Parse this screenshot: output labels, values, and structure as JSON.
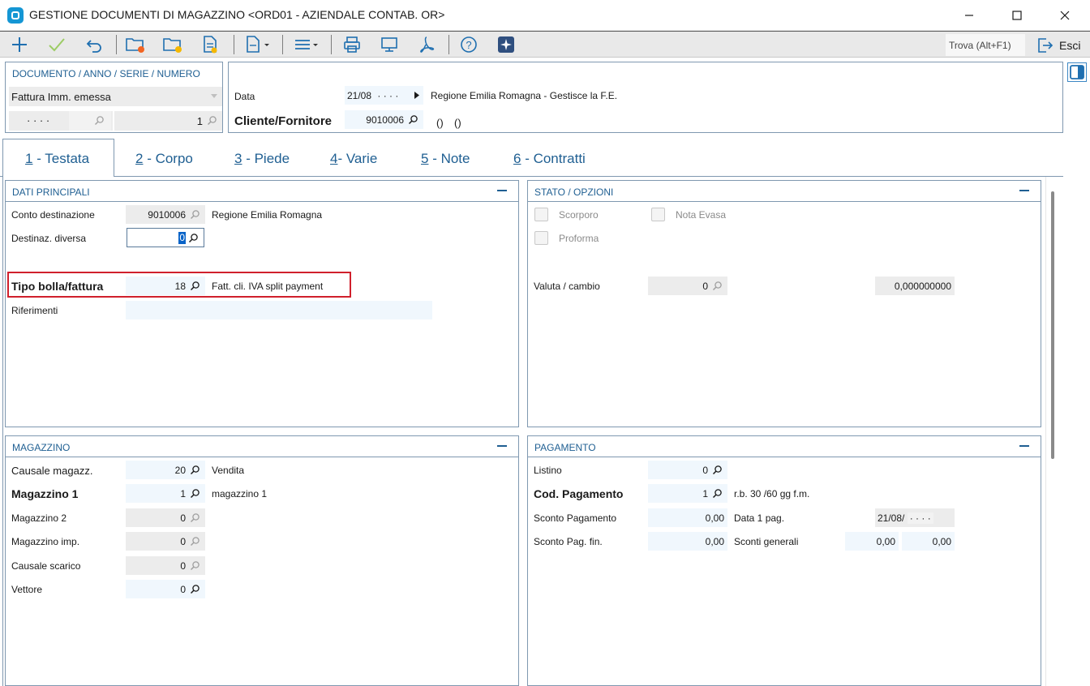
{
  "window": {
    "title": "GESTIONE DOCUMENTI DI MAGAZZINO <ORD01 - AZIENDALE CONTAB. OR>",
    "minimize": "—",
    "maximize": "☐",
    "close": "✕"
  },
  "toolbar": {
    "find_label": "Trova (Alt+F1)",
    "exit_label": "Esci"
  },
  "document": {
    "panel_title": "DOCUMENTO / ANNO / SERIE / NUMERO",
    "type": "Fattura Imm. emessa",
    "year": "· · · ·",
    "number": "1"
  },
  "header": {
    "date_label": "Data",
    "date_value": "21/08",
    "date_mask": "· · · ·",
    "client_label": "Cliente/Fornitore",
    "client_code": "9010006",
    "client_name": "Regione Emilia Romagna  - Gestisce la F.E.",
    "client_extra_1": "()",
    "client_extra_2": "()"
  },
  "tabs": [
    {
      "key": "1",
      "label": " - Testata",
      "active": true
    },
    {
      "key": "2",
      "label": " - Corpo",
      "active": false
    },
    {
      "key": "3",
      "label": " - Piede",
      "active": false
    },
    {
      "key": "4",
      "label": "- Varie",
      "active": false
    },
    {
      "key": "5",
      "label": " - Note",
      "active": false
    },
    {
      "key": "6",
      "label": " - Contratti",
      "active": false
    }
  ],
  "dati_principali": {
    "title": "DATI PRINCIPALI",
    "conto_label": "Conto destinazione",
    "conto_value": "9010006",
    "conto_desc": "Regione Emilia Romagna",
    "destinaz_label": "Destinaz. diversa",
    "destinaz_value": "0",
    "tipo_label": "Tipo bolla/fattura",
    "tipo_value": "18",
    "tipo_desc": "Fatt. cli. IVA split payment",
    "riferimenti_label": "Riferimenti",
    "riferimenti_value": ""
  },
  "stato_opzioni": {
    "title": "STATO / OPZIONI",
    "scorporo_label": "Scorporo",
    "nota_evasa_label": "Nota Evasa",
    "proforma_label": "Proforma",
    "valuta_label": "Valuta / cambio",
    "valuta_value": "0",
    "cambio_value": "0,000000000"
  },
  "magazzino": {
    "title": "MAGAZZINO",
    "causale_label": "Causale magazz.",
    "causale_value": "20",
    "causale_desc": "Vendita",
    "mag1_label": "Magazzino 1",
    "mag1_value": "1",
    "mag1_desc": "magazzino 1",
    "mag2_label": "Magazzino 2",
    "mag2_value": "0",
    "magimp_label": "Magazzino imp.",
    "magimp_value": "0",
    "scarico_label": "Causale scarico",
    "scarico_value": "0",
    "vettore_label": "Vettore",
    "vettore_value": "0"
  },
  "pagamento": {
    "title": "PAGAMENTO",
    "listino_label": "Listino",
    "listino_value": "0",
    "codpag_label": "Cod. Pagamento",
    "codpag_value": "1",
    "codpag_desc": "r.b. 30 /60 gg f.m.",
    "sconto_pag_label": "Sconto Pagamento",
    "sconto_pag_value": "0,00",
    "data1_label": "Data 1 pag.",
    "data1_value": "21/08/",
    "data1_mask": "· · · ·",
    "sconto_fin_label": "Sconto Pag. fin.",
    "sconto_fin_value": "0,00",
    "sconti_gen_label": "Sconti generali",
    "sconti_gen_1": "0,00",
    "sconti_gen_2": "0,00"
  },
  "colors": {
    "accent_blue": "#1f5f92",
    "border": "#7f98b0",
    "highlight_red": "#d0202c",
    "field_blue": "#f0f7fd",
    "field_grey": "#ececec"
  }
}
